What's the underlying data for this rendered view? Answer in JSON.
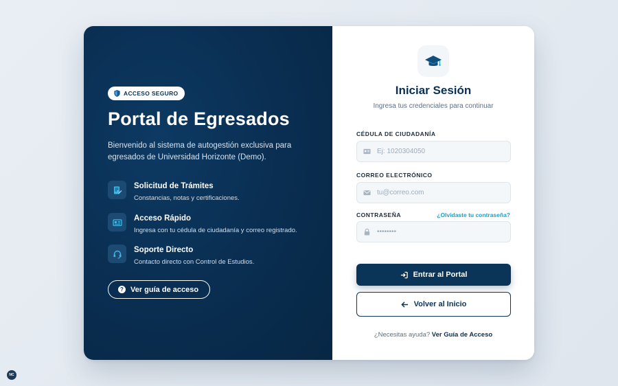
{
  "left": {
    "badge": "ACCESO SEGURO",
    "title": "Portal de Egresados",
    "description": "Bienvenido al sistema de autogestión exclusiva para egresados de Universidad Horizonte (Demo).",
    "features": [
      {
        "title": "Solicitud de Trámites",
        "text": "Constancias, notas y certificaciones.",
        "icon": "document-edit-icon"
      },
      {
        "title": "Acceso Rápido",
        "text": "Ingresa con tu cédula de ciudadanía y correo registrado.",
        "icon": "id-card-icon"
      },
      {
        "title": "Soporte Directo",
        "text": "Contacto directo con Control de Estudios.",
        "icon": "headset-icon"
      }
    ],
    "guide_button": "Ver guía de acceso"
  },
  "right": {
    "title": "Iniciar Sesión",
    "subtitle": "Ingresa tus credenciales para continuar",
    "fields": {
      "cedula": {
        "label": "CÉDULA DE CIUDADANÍA",
        "placeholder": "Ej: 1020304050",
        "value": ""
      },
      "email": {
        "label": "CORREO ELECTRÓNICO",
        "placeholder": "tu@correo.com",
        "value": ""
      },
      "password": {
        "label": "CONTRASEÑA",
        "placeholder": "••••••••",
        "value": ""
      }
    },
    "forgot_link": "¿Olvidaste tu contraseña?",
    "login_button": "Entrar al Portal",
    "back_button": "Volver al Inicio",
    "help_text": "¿Necesitas ayuda?",
    "help_link": "Ver Guía de Acceso"
  },
  "corner_badge": "NC",
  "colors": {
    "navy": "#0a2f53",
    "accent": "#1aa0c8",
    "background": "#e5ebf2"
  }
}
